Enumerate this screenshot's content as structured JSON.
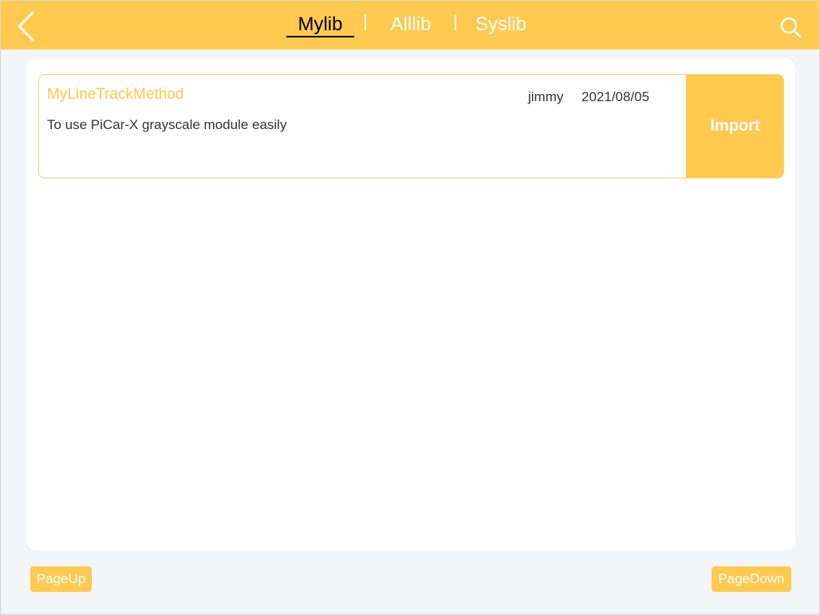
{
  "tabs": [
    {
      "label": "Mylib",
      "active": true
    },
    {
      "label": "Alllib",
      "active": false
    },
    {
      "label": "Syslib",
      "active": false
    }
  ],
  "icons": {
    "back": "chevron-left-icon",
    "search": "search-icon"
  },
  "colors": {
    "accent": "#ffca4f",
    "title": "#ffc94a",
    "card_border": "#e3dc6e"
  },
  "library": {
    "items": [
      {
        "title": "MyLineTrackMethod",
        "author": "jimmy",
        "date": "2021/08/05",
        "description": "To use PiCar-X grayscale module easily",
        "action_label": "Import"
      }
    ]
  },
  "pagination": {
    "prev_label": "PageUp",
    "next_label": "PageDown"
  }
}
